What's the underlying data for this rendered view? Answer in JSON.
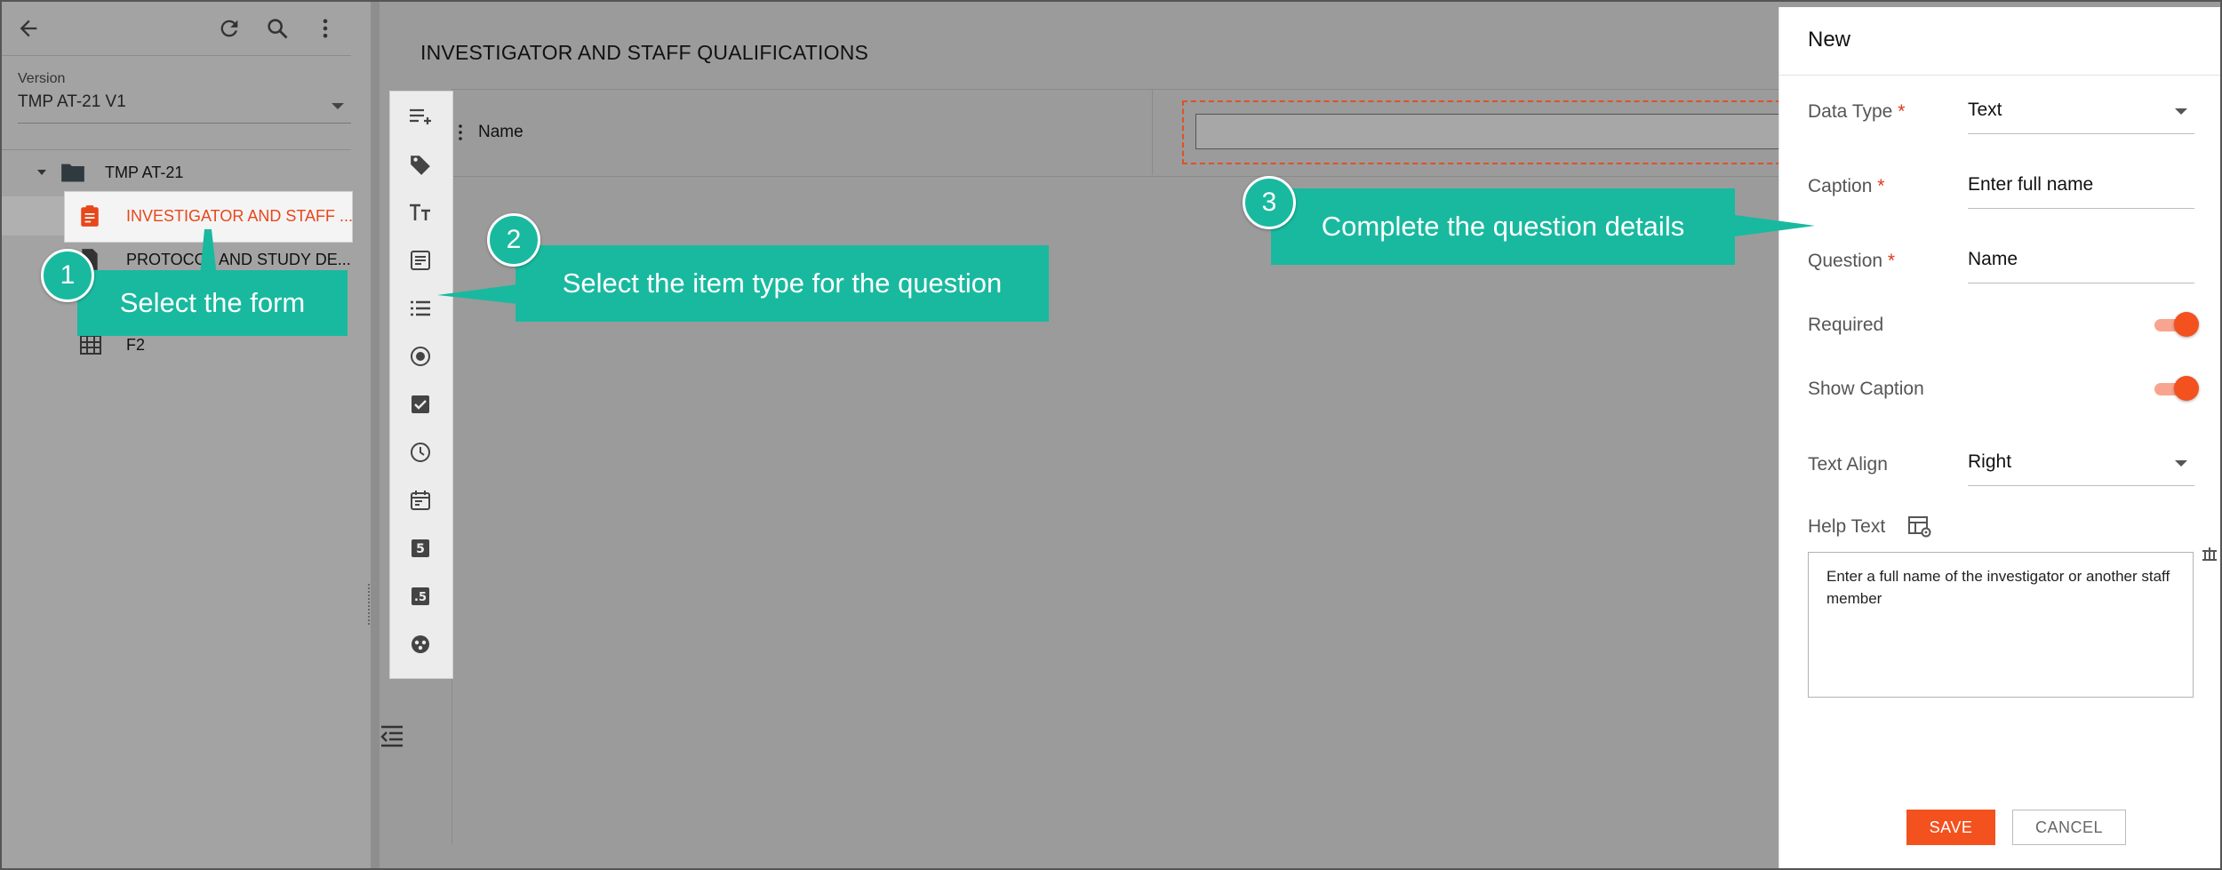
{
  "tree_panel": {
    "version_label": "Version",
    "version_value": "TMP AT-21 V1",
    "items": [
      {
        "label": "TMP AT-21"
      },
      {
        "label": "INVESTIGATOR AND STAFF ..."
      },
      {
        "label": "PROTOCOL AND STUDY DE..."
      },
      {
        "label": "F2"
      }
    ]
  },
  "form": {
    "title": "INVESTIGATOR AND STAFF QUALIFICATIONS",
    "row_name_label": "Name"
  },
  "properties": {
    "title": "New",
    "data_type_label": "Data Type",
    "data_type_value": "Text",
    "caption_label": "Caption",
    "caption_value": "Enter full name",
    "question_label": "Question",
    "question_value": "Name",
    "required_label": "Required",
    "required_on": true,
    "show_caption_label": "Show Caption",
    "show_caption_on": true,
    "text_align_label": "Text Align",
    "text_align_value": "Right",
    "help_text_label": "Help Text",
    "help_text_value": "Enter a full name of the investigator or another staff member",
    "required_marker": "*",
    "save_label": "SAVE",
    "cancel_label": "CANCEL"
  },
  "callouts": [
    {
      "number": "1",
      "text": "Select the form"
    },
    {
      "number": "2",
      "text": "Select the item type for the question"
    },
    {
      "number": "3",
      "text": "Complete the question details"
    }
  ],
  "colors": {
    "accent": "#f3511e",
    "callout": "#19b99f",
    "selected_text": "#e8471b"
  }
}
